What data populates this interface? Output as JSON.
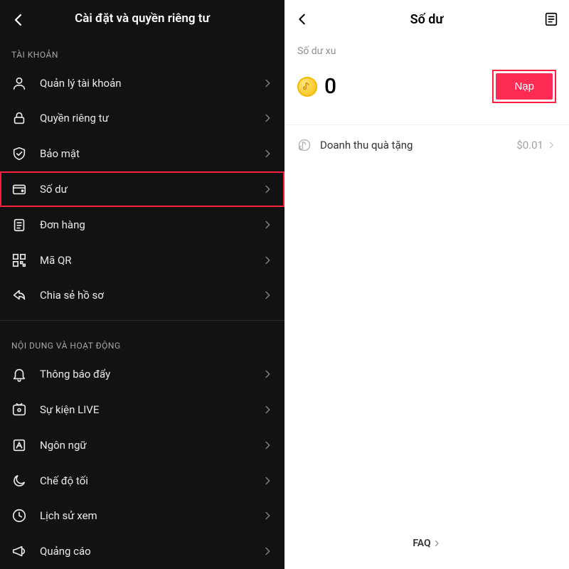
{
  "left": {
    "title": "Cài đặt và quyền riêng tư",
    "sections": [
      {
        "label": "TÀI KHOẢN",
        "items": [
          {
            "icon": "person-icon",
            "label": "Quản lý tài khoản"
          },
          {
            "icon": "lock-icon",
            "label": "Quyền riêng tư"
          },
          {
            "icon": "shield-icon",
            "label": "Bảo mật"
          },
          {
            "icon": "wallet-icon",
            "label": "Số dư",
            "highlighted": true
          },
          {
            "icon": "clipboard-icon",
            "label": "Đơn hàng"
          },
          {
            "icon": "qr-icon",
            "label": "Mã QR"
          },
          {
            "icon": "share-icon",
            "label": "Chia sẻ hồ sơ"
          }
        ]
      },
      {
        "label": "NỘI DUNG VÀ HOẠT ĐỘNG",
        "items": [
          {
            "icon": "bell-icon",
            "label": "Thông báo đẩy"
          },
          {
            "icon": "live-icon",
            "label": "Sự kiện LIVE"
          },
          {
            "icon": "language-icon",
            "label": "Ngôn ngữ"
          },
          {
            "icon": "moon-icon",
            "label": "Chế độ tối"
          },
          {
            "icon": "history-icon",
            "label": "Lịch sử xem"
          },
          {
            "icon": "megaphone-icon",
            "label": "Quảng cáo"
          }
        ]
      }
    ]
  },
  "right": {
    "title": "Số dư",
    "subhead": "Số dư xu",
    "balance": "0",
    "recharge_label": "Nạp",
    "revenue": {
      "label": "Doanh thu quà tặng",
      "amount": "$0.01"
    },
    "faq_label": "FAQ"
  }
}
